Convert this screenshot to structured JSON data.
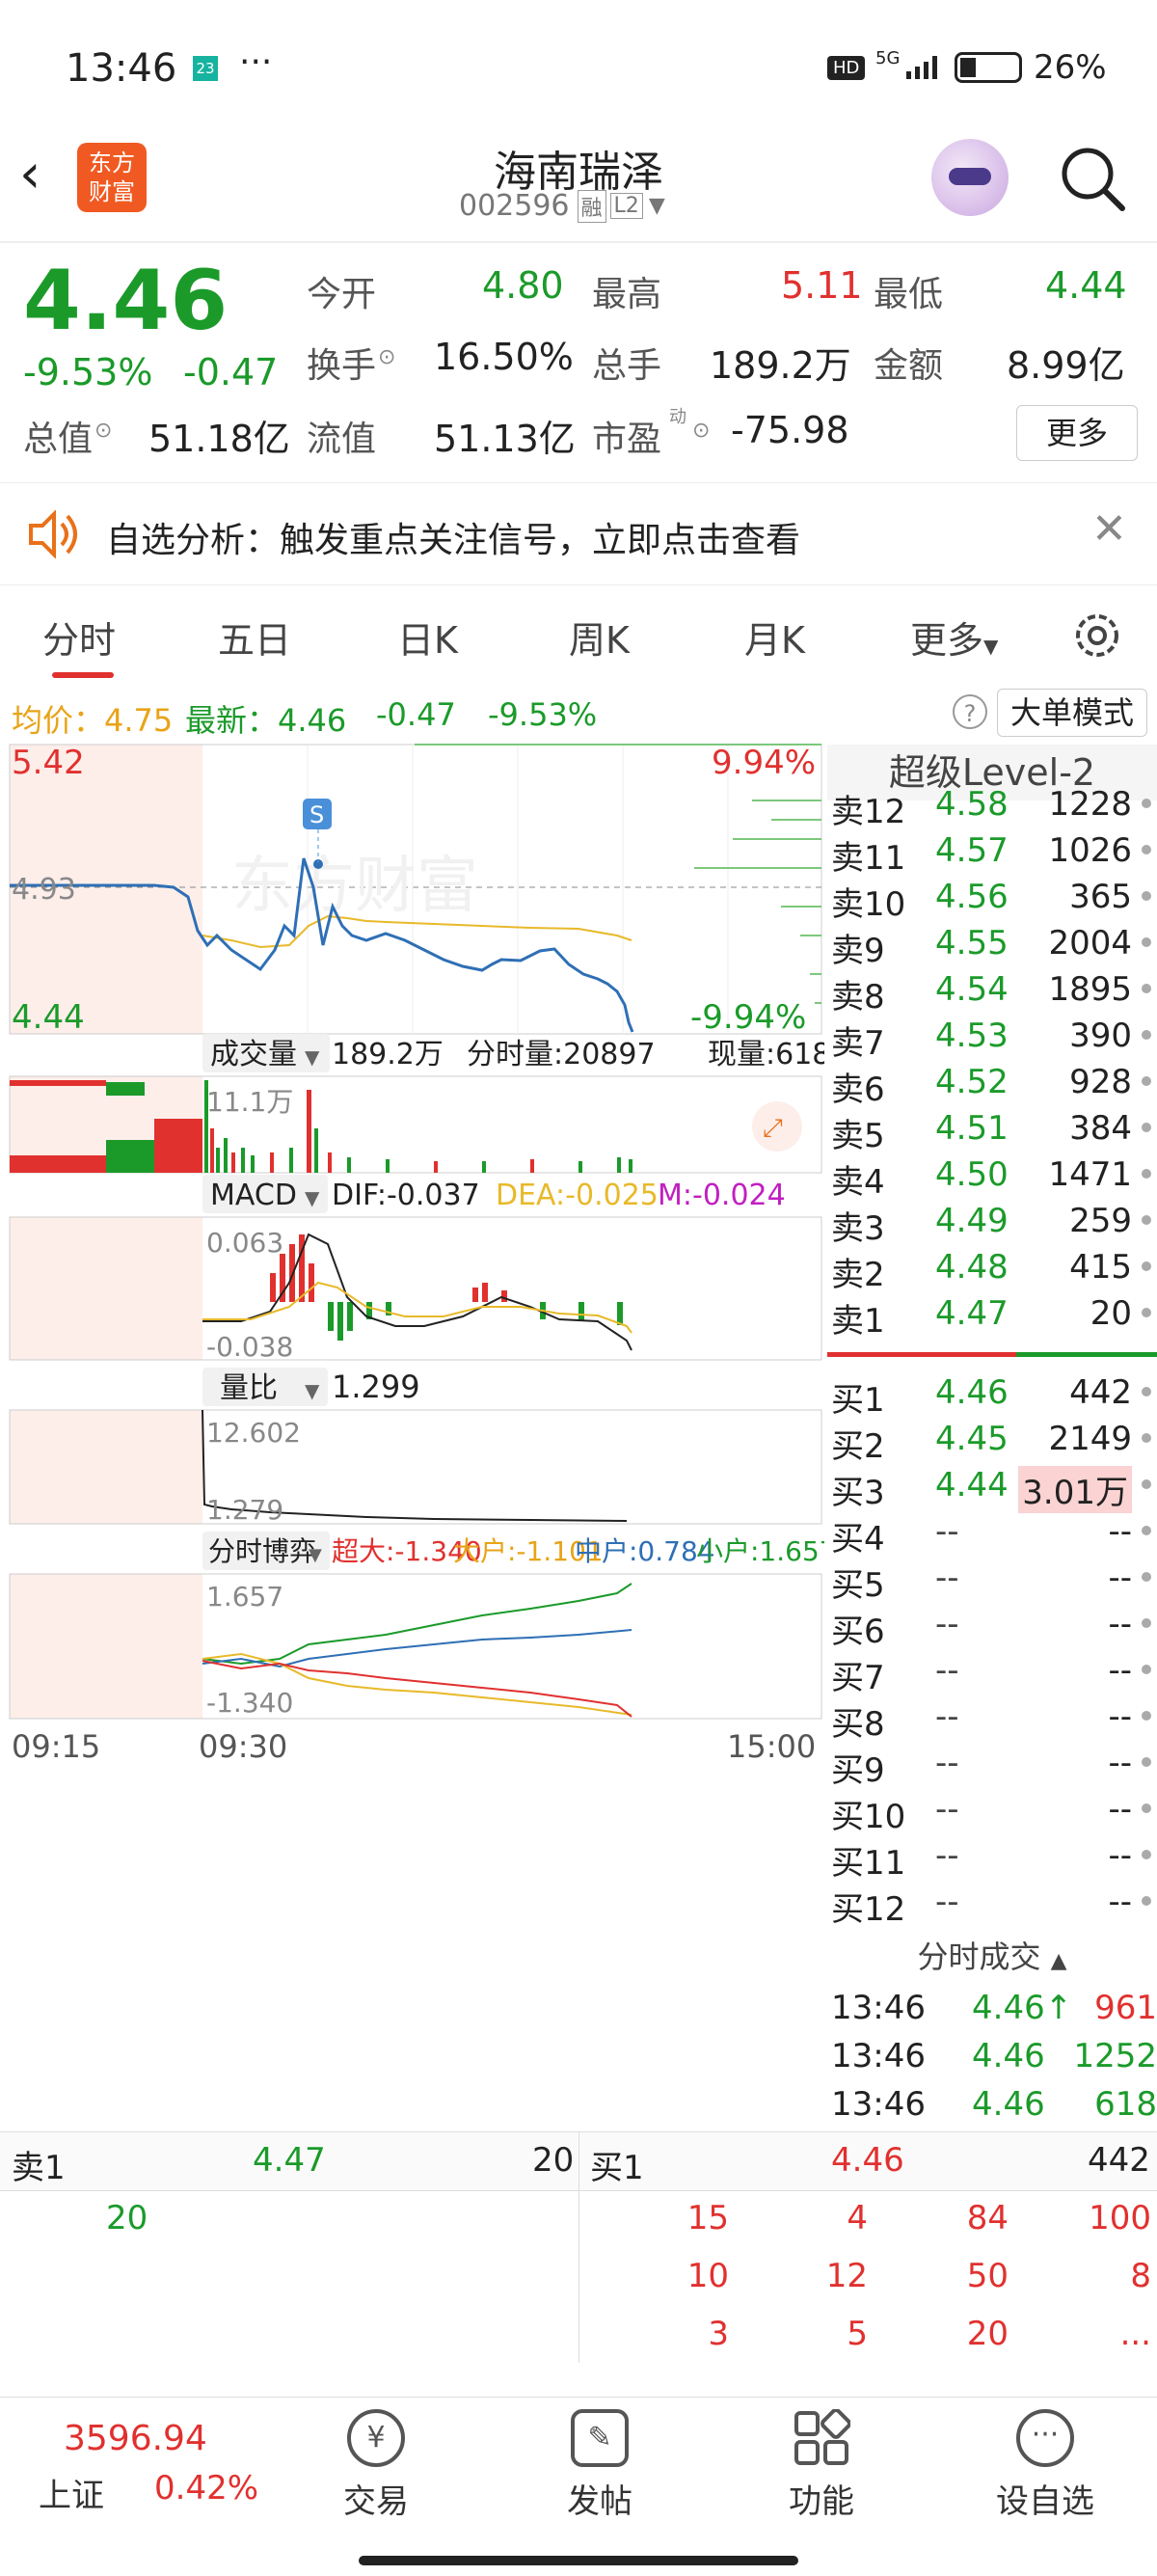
{
  "status": {
    "time": "13:46",
    "notif_badge": "23",
    "dots": "···",
    "hd": "HD",
    "net": "5G",
    "battery": "26%"
  },
  "header": {
    "name": "海南瑞泽",
    "code": "002596",
    "rong": "融",
    "l2": "L2",
    "logo_line1": "东方",
    "logo_line2": "财富"
  },
  "quote": {
    "price": "4.46",
    "pct": "-9.53%",
    "chg": "-0.47",
    "open_label": "今开",
    "open": "4.80",
    "high_label": "最高",
    "high": "5.11",
    "low_label": "最低",
    "low": "4.44",
    "turnover_label": "换手",
    "turnover": "16.50%",
    "volume_label": "总手",
    "volume": "189.2万",
    "amount_label": "金额",
    "amount": "8.99亿",
    "mcap_label": "总值",
    "mcap": "51.18亿",
    "float_label": "流值",
    "float": "51.13亿",
    "pe_label": "市盈",
    "pe_sup": "动",
    "pe": "-75.98",
    "more": "更多"
  },
  "banner": {
    "text": "自选分析：触发重点关注信号，立即点击查看"
  },
  "tabs": [
    "分时",
    "五日",
    "日K",
    "周K",
    "月K",
    "更多"
  ],
  "subinfo": {
    "avg": "均价：4.75",
    "latest": "最新：4.46",
    "chg": "-0.47",
    "pct": "-9.53%",
    "mode": "大单模式"
  },
  "chart": {
    "y_top": "5.42",
    "y_mid": "4.93",
    "y_bot": "4.44",
    "pct_top": "9.94%",
    "pct_bot": "-9.94%",
    "watermark": "东方财富",
    "marker": "S",
    "vol_label": "成交量",
    "vol_total": "189.2万",
    "vol_fen": "分时量:20897",
    "vol_now": "现量:618",
    "vol_max": "11.1万",
    "macd_label": "MACD",
    "dif": "DIF:-0.037",
    "dea": "DEA:-0.025",
    "m": "M:-0.024",
    "macd_top": "0.063",
    "macd_bot": "-0.038",
    "lb_label": "量比",
    "lb_val": "1.299",
    "lb_top": "12.602",
    "lb_bot": "1.279",
    "bo_label": "分时博弈",
    "bo_super": "超大:-1.340",
    "bo_big": "大户:-1.101",
    "bo_mid": "中户:0.784",
    "bo_small": "小户:1.657",
    "bo_top": "1.657",
    "bo_bot": "-1.340",
    "t_start": "09:15",
    "t_open": "09:30",
    "t_end": "15:00"
  },
  "level2": {
    "title": "超级Level-2",
    "sells": [
      {
        "label": "卖12",
        "price": "4.58",
        "vol": "1228"
      },
      {
        "label": "卖11",
        "price": "4.57",
        "vol": "1026"
      },
      {
        "label": "卖10",
        "price": "4.56",
        "vol": "365"
      },
      {
        "label": "卖9",
        "price": "4.55",
        "vol": "2004"
      },
      {
        "label": "卖8",
        "price": "4.54",
        "vol": "1895"
      },
      {
        "label": "卖7",
        "price": "4.53",
        "vol": "390"
      },
      {
        "label": "卖6",
        "price": "4.52",
        "vol": "928"
      },
      {
        "label": "卖5",
        "price": "4.51",
        "vol": "384"
      },
      {
        "label": "卖4",
        "price": "4.50",
        "vol": "1471"
      },
      {
        "label": "卖3",
        "price": "4.49",
        "vol": "259"
      },
      {
        "label": "卖2",
        "price": "4.48",
        "vol": "415"
      },
      {
        "label": "卖1",
        "price": "4.47",
        "vol": "20"
      }
    ],
    "buys": [
      {
        "label": "买1",
        "price": "4.46",
        "vol": "442"
      },
      {
        "label": "买2",
        "price": "4.45",
        "vol": "2149"
      },
      {
        "label": "买3",
        "price": "4.44",
        "vol": "3.01万"
      },
      {
        "label": "买4",
        "price": "--",
        "vol": "--"
      },
      {
        "label": "买5",
        "price": "--",
        "vol": "--"
      },
      {
        "label": "买6",
        "price": "--",
        "vol": "--"
      },
      {
        "label": "买7",
        "price": "--",
        "vol": "--"
      },
      {
        "label": "买8",
        "price": "--",
        "vol": "--"
      },
      {
        "label": "买9",
        "price": "--",
        "vol": "--"
      },
      {
        "label": "买10",
        "price": "--",
        "vol": "--"
      },
      {
        "label": "买11",
        "price": "--",
        "vol": "--"
      },
      {
        "label": "买12",
        "price": "--",
        "vol": "--"
      }
    ],
    "trades_title": "分时成交",
    "trades": [
      {
        "time": "13:46",
        "price": "4.46↑",
        "vol": "961"
      },
      {
        "time": "13:46",
        "price": "4.46",
        "vol": "1252"
      },
      {
        "time": "13:46",
        "price": "4.46",
        "vol": "618"
      }
    ]
  },
  "bottom_queue": {
    "sell_label": "卖1",
    "sell_price": "4.47",
    "sell_vol": "20",
    "sell_orders": [
      "20"
    ],
    "buy_label": "买1",
    "buy_price": "4.46",
    "buy_vol": "442",
    "buy_orders": [
      [
        "15",
        "4",
        "84",
        "100"
      ],
      [
        "10",
        "12",
        "50",
        "8"
      ],
      [
        "3",
        "5",
        "20",
        "..."
      ]
    ]
  },
  "nav": {
    "index_val": "3596.94",
    "index_name": "上证",
    "index_pct": "0.42%",
    "items": [
      "交易",
      "发帖",
      "功能",
      "设自选"
    ]
  }
}
